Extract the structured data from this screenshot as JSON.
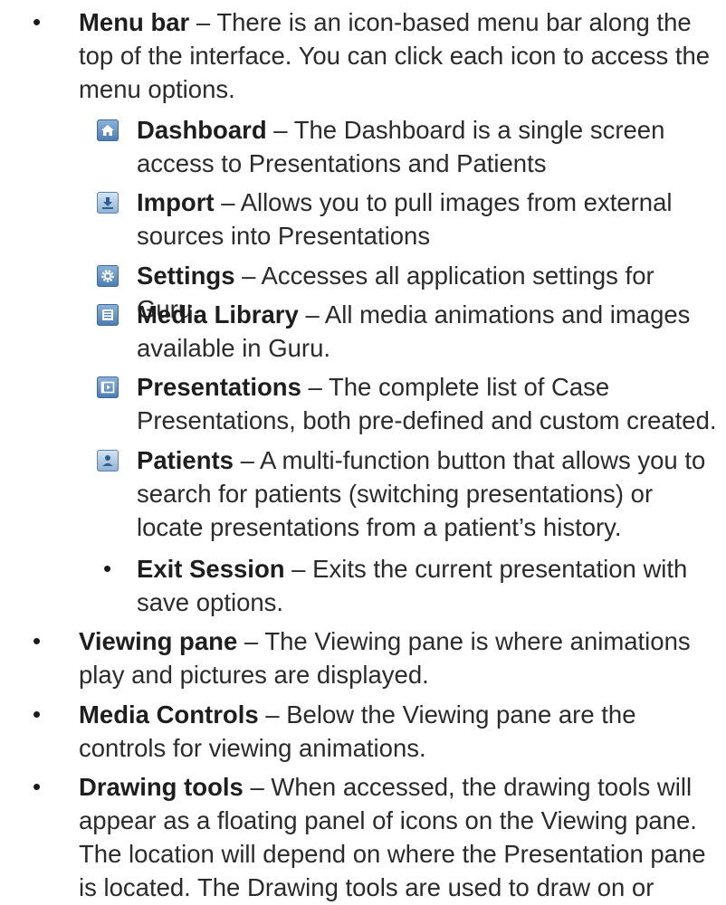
{
  "items": {
    "menu_bar": {
      "term": "Menu bar",
      "desc": " – There is an icon-based menu bar along the top of the interface. You can click each icon to access the menu options."
    },
    "sub": [
      {
        "icon": "home-icon",
        "term": "Dashboard",
        "desc": " – The Dashboard is a single screen access to Presentations and Patients"
      },
      {
        "icon": "import-icon",
        "term": "Import",
        "desc": " – Allows you to pull images from external sources into Presentations"
      },
      {
        "icon": "gear-icon",
        "term": "Settings",
        "desc": " – Accesses all application settings for Guru."
      },
      {
        "icon": "list-icon",
        "term": "Media Library",
        "desc": " – All media animations and images available in Guru."
      },
      {
        "icon": "film-icon",
        "term": "Presentations",
        "desc": " – The complete list of Case Presentations, both pre-defined and custom created."
      },
      {
        "icon": "person-icon",
        "term": "Patients",
        "desc": " – A multi-function button that allows you to search for patients (switching presentations) or locate presentations from a patient’s history."
      }
    ],
    "exit_session": {
      "term": "Exit Session",
      "desc": " – Exits the current presentation with save options."
    },
    "viewing_pane": {
      "term": "Viewing pane",
      "desc": " – The Viewing pane is where animations play and pictures are displayed."
    },
    "media_controls": {
      "term": "Media Controls",
      "desc": " – Below the Viewing pane are the controls for viewing animations."
    },
    "drawing_tools": {
      "term": "Drawing tools",
      "desc": " – When accessed, the drawing tools will appear as a floating panel of icons on the Viewing pane. The location will depend on where the Presentation pane is located. The Drawing tools are used to draw on or"
    },
    "bullet": "•"
  },
  "colors": {
    "text": "#2b2b2b",
    "icon_bg": "#5b8cc1"
  }
}
